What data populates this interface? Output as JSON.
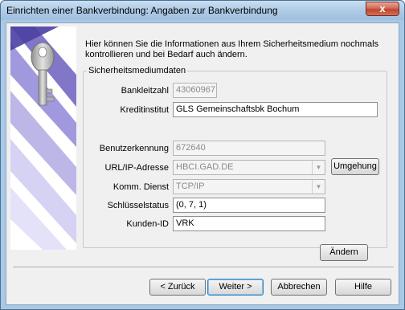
{
  "window": {
    "title": "Einrichten einer Bankverbindung: Angaben zur Bankverbindung",
    "close_glyph": "x"
  },
  "intro_text": "Hier können Sie die Informationen aus Ihrem Sicherheitsmedium nochmals kontrollieren und bei Bedarf auch ändern.",
  "group": {
    "title": "Sicherheitsmediumdaten"
  },
  "fields": {
    "bankleitzahl": {
      "label": "Bankleitzahl",
      "value": "43060967"
    },
    "kreditinstitut": {
      "label": "Kreditinstitut",
      "value": "GLS Gemeinschaftsbk Bochum"
    },
    "benutzerkennung": {
      "label": "Benutzerkennung",
      "value": "672640"
    },
    "url_ip": {
      "label": "URL/IP-Adresse",
      "value": "HBCI.GAD.DE"
    },
    "komm_dienst": {
      "label": "Komm. Dienst",
      "value": "TCP/IP"
    },
    "schluesselstatus": {
      "label": "Schlüsselstatus",
      "value": "(0, 7, 1)"
    },
    "kunden_id": {
      "label": "Kunden-ID",
      "value": "VRK"
    }
  },
  "buttons": {
    "umgehung": "Umgehung",
    "aendern": "Ändern",
    "zurueck": "< Zurück",
    "weiter": "Weiter >",
    "abbrechen": "Abbrechen",
    "hilfe": "Hilfe"
  },
  "icons": {
    "combo_arrow": "▼",
    "key": "key-icon"
  },
  "colors": {
    "titlebar": "#afcbe6",
    "client_bg": "#f0f0f0",
    "close_button": "#c0452e",
    "panel_purple": "#7b6fc4"
  }
}
